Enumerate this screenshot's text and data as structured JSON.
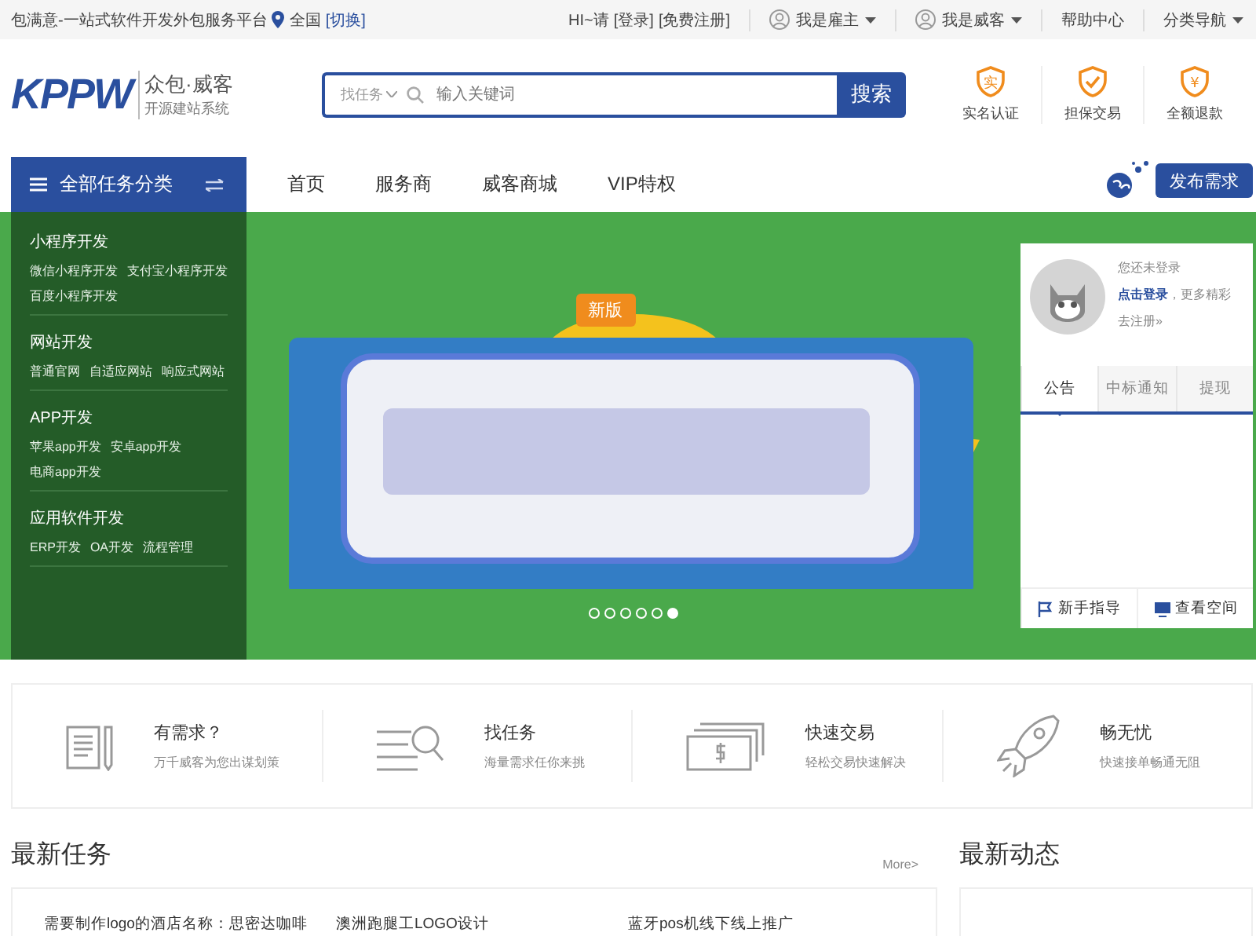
{
  "topbar": {
    "site_text": "包满意-一站式软件开发外包服务平台",
    "location": "全国",
    "switch_link": "[切换]",
    "greeting": "HI~请",
    "login": "[登录]",
    "register": "[免费注册]",
    "menus": [
      {
        "label": "我是雇主",
        "kind": "user"
      },
      {
        "label": "我是威客",
        "kind": "user"
      },
      {
        "label": "帮助中心",
        "kind": "link"
      },
      {
        "label": "分类导航",
        "kind": "dropdown"
      }
    ]
  },
  "header": {
    "logo": {
      "mark": "KPPW",
      "name": "众包·威客",
      "sub": "开源建站系统"
    },
    "search": {
      "scope": "找任务",
      "placeholder": "输入关键词",
      "button": "搜索"
    },
    "badges": [
      {
        "label": "实名认证",
        "glyph": "实"
      },
      {
        "label": "担保交易"
      },
      {
        "label": "全额退款",
        "glyph": "¥"
      }
    ]
  },
  "nav": {
    "category_title": "全部任务分类",
    "items": [
      {
        "label": "首页",
        "selected": false
      },
      {
        "label": "服务商",
        "selected": false
      },
      {
        "label": "威客商城",
        "selected": false
      },
      {
        "label": "VIP特权",
        "selected": false
      }
    ],
    "publish_button": "发布需求"
  },
  "categories": [
    {
      "title": "小程序开发",
      "links": [
        "微信小程序开发",
        "支付宝小程序开发",
        "百度小程序开发"
      ]
    },
    {
      "title": "网站开发",
      "links": [
        "普通官网",
        "自适应网站",
        "响应式网站"
      ]
    },
    {
      "title": "APP开发",
      "links": [
        "苹果app开发",
        "安卓app开发",
        "电商app开发"
      ]
    },
    {
      "title": "应用软件开发",
      "links": [
        "ERP开发",
        "OA开发",
        "流程管理"
      ]
    }
  ],
  "banner": {
    "badge": "新版",
    "dots": [
      {
        "selected": false
      },
      {
        "selected": false
      },
      {
        "selected": false
      },
      {
        "selected": false
      },
      {
        "selected": false
      },
      {
        "selected": true
      }
    ]
  },
  "user_panel": {
    "status": "您还未登录",
    "login_link": "点击登录",
    "login_suffix": "，更多精彩",
    "register": "去注册»",
    "tabs": [
      {
        "label": "公告",
        "selected": true
      },
      {
        "label": "中标通知",
        "selected": false
      },
      {
        "label": "提现",
        "selected": false
      }
    ],
    "footer_links": [
      "新手指导",
      "查看空间"
    ]
  },
  "features": [
    {
      "kind": "document",
      "title": "有需求？",
      "desc": "万千威客为您出谋划策"
    },
    {
      "kind": "search",
      "title": "找任务",
      "desc": "海量需求任你来挑"
    },
    {
      "kind": "money",
      "title": "快速交易",
      "desc": "轻松交易快速解决"
    },
    {
      "kind": "rocket",
      "title": "畅无忧",
      "desc": "快速接单畅通无阻"
    }
  ],
  "tasks": {
    "title": "最新任务",
    "more": "More>",
    "items": [
      "需要制作logo的酒店名称：思密达咖啡",
      "澳洲跑腿工LOGO设计",
      "蓝牙pos机线下线上推广"
    ]
  },
  "news": {
    "title": "最新动态"
  }
}
